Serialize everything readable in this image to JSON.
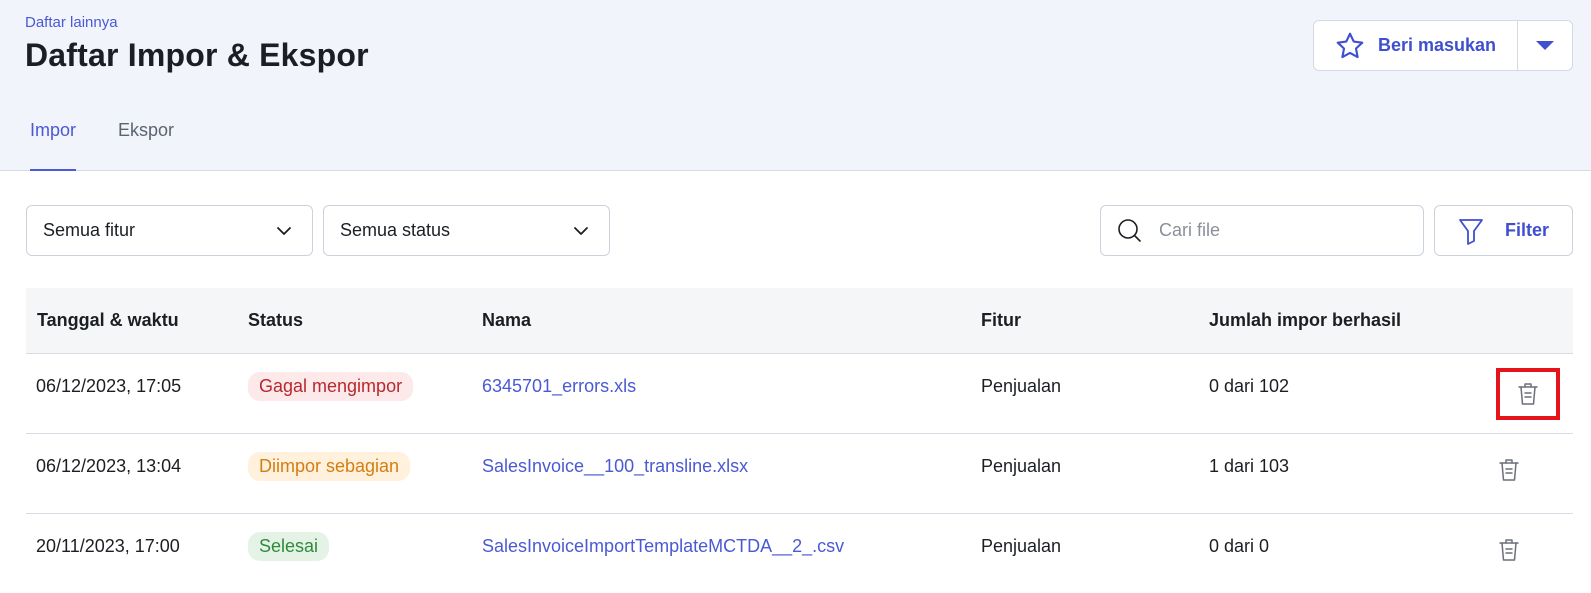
{
  "header": {
    "breadcrumb": "Daftar lainnya",
    "title": "Daftar Impor & Ekspor",
    "feedback_label": "Beri masukan"
  },
  "tabs": [
    {
      "label": "Impor",
      "active": true
    },
    {
      "label": "Ekspor",
      "active": false
    }
  ],
  "filters": {
    "feature_select": "Semua fitur",
    "status_select": "Semua status",
    "search_placeholder": "Cari file",
    "filter_button": "Filter"
  },
  "table": {
    "columns": [
      "Tanggal & waktu",
      "Status",
      "Nama",
      "Fitur",
      "Jumlah impor berhasil"
    ],
    "rows": [
      {
        "datetime": "06/12/2023, 17:05",
        "status": "Gagal mengimpor",
        "status_type": "failed",
        "name": "6345701_errors.xls",
        "feature": "Penjualan",
        "count": "0 dari 102"
      },
      {
        "datetime": "06/12/2023, 13:04",
        "status": "Diimpor sebagian",
        "status_type": "partial",
        "name": "SalesInvoice__100_transline.xlsx",
        "feature": "Penjualan",
        "count": "1 dari 103"
      },
      {
        "datetime": "20/11/2023, 17:00",
        "status": "Selesai",
        "status_type": "done",
        "name": "SalesInvoiceImportTemplateMCTDA__2_.csv",
        "feature": "Penjualan",
        "count": "0 dari 0"
      }
    ]
  },
  "colors": {
    "accent": "#4a59d4",
    "failed": "#b6292f",
    "partial": "#d57d12",
    "done": "#2f8a3b",
    "highlight": "#e5141b"
  },
  "icons": {
    "feedback": "star-icon",
    "dropdown": "caret-down-icon",
    "select": "chevron-down-icon",
    "search": "search-icon",
    "filter": "funnel-icon",
    "delete": "trash-icon"
  }
}
